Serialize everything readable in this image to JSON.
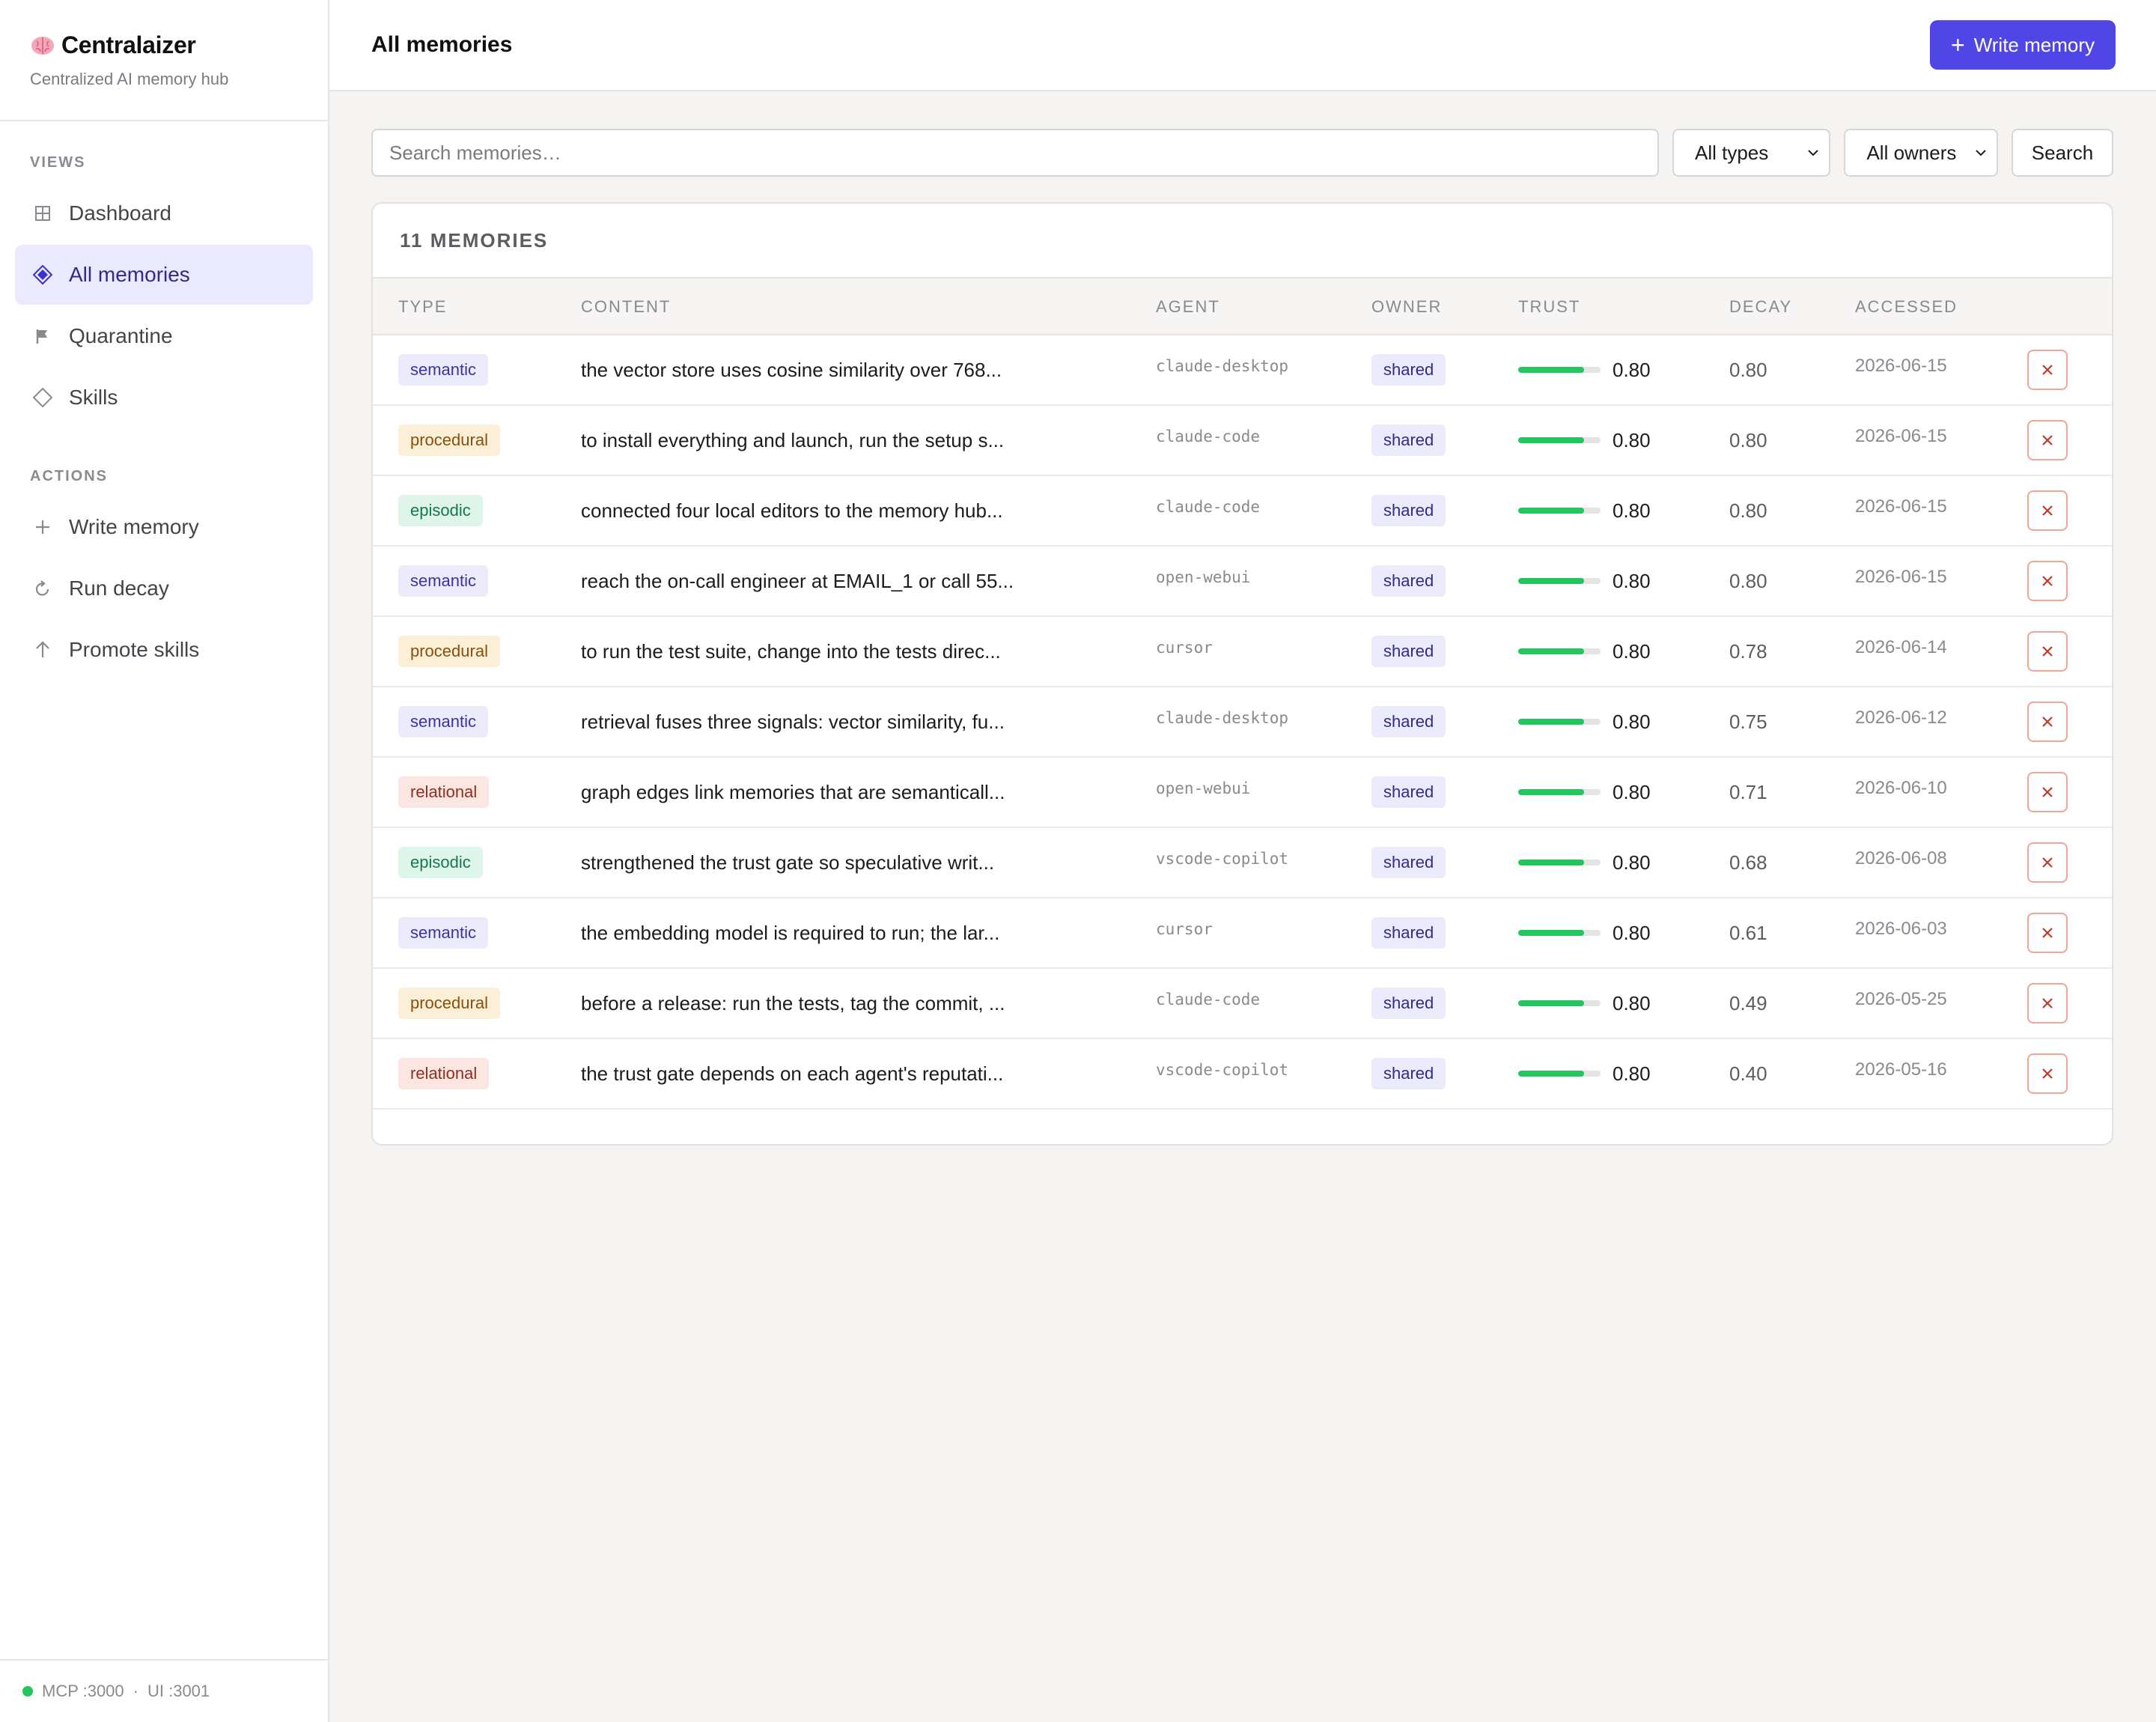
{
  "app": {
    "name": "Centralaizer",
    "subtitle": "Centralized AI memory hub"
  },
  "sidebar": {
    "views_label": "VIEWS",
    "views": [
      {
        "label": "Dashboard",
        "icon": "grid-icon"
      },
      {
        "label": "All memories",
        "icon": "diamond-filled-icon",
        "active": true
      },
      {
        "label": "Quarantine",
        "icon": "flag-icon"
      },
      {
        "label": "Skills",
        "icon": "diamond-outline-icon"
      }
    ],
    "actions_label": "ACTIONS",
    "actions": [
      {
        "label": "Write memory",
        "icon": "plus-icon"
      },
      {
        "label": "Run decay",
        "icon": "refresh-icon"
      },
      {
        "label": "Promote skills",
        "icon": "arrow-up-icon"
      }
    ],
    "footer": {
      "mcp": "MCP :3000",
      "separator": "·",
      "ui": "UI :3001",
      "status_color": "#22c55e"
    }
  },
  "header": {
    "title": "All memories",
    "write_button": "Write memory"
  },
  "filters": {
    "search_placeholder": "Search memories…",
    "type_select": "All types",
    "owner_select": "All owners",
    "search_button": "Search"
  },
  "table": {
    "count_label": "11 MEMORIES",
    "columns": [
      "TYPE",
      "CONTENT",
      "AGENT",
      "OWNER",
      "TRUST",
      "DECAY",
      "ACCESSED"
    ],
    "rows": [
      {
        "type": "semantic",
        "content": "the vector store uses cosine similarity over 768...",
        "agent": "claude-desktop",
        "owner": "shared",
        "trust": "0.80",
        "trust_fraction": 0.8,
        "decay": "0.80",
        "accessed": "2026-06-15"
      },
      {
        "type": "procedural",
        "content": "to install everything and launch, run the setup s...",
        "agent": "claude-code",
        "owner": "shared",
        "trust": "0.80",
        "trust_fraction": 0.8,
        "decay": "0.80",
        "accessed": "2026-06-15"
      },
      {
        "type": "episodic",
        "content": "connected four local editors to the memory hub...",
        "agent": "claude-code",
        "owner": "shared",
        "trust": "0.80",
        "trust_fraction": 0.8,
        "decay": "0.80",
        "accessed": "2026-06-15"
      },
      {
        "type": "semantic",
        "content": "reach the on-call engineer at EMAIL_1 or call 55...",
        "agent": "open-webui",
        "owner": "shared",
        "trust": "0.80",
        "trust_fraction": 0.8,
        "decay": "0.80",
        "accessed": "2026-06-15"
      },
      {
        "type": "procedural",
        "content": "to run the test suite, change into the tests direc...",
        "agent": "cursor",
        "owner": "shared",
        "trust": "0.80",
        "trust_fraction": 0.8,
        "decay": "0.78",
        "accessed": "2026-06-14"
      },
      {
        "type": "semantic",
        "content": "retrieval fuses three signals: vector similarity, fu...",
        "agent": "claude-desktop",
        "owner": "shared",
        "trust": "0.80",
        "trust_fraction": 0.8,
        "decay": "0.75",
        "accessed": "2026-06-12"
      },
      {
        "type": "relational",
        "content": "graph edges link memories that are semanticall...",
        "agent": "open-webui",
        "owner": "shared",
        "trust": "0.80",
        "trust_fraction": 0.8,
        "decay": "0.71",
        "accessed": "2026-06-10"
      },
      {
        "type": "episodic",
        "content": "strengthened the trust gate so speculative writ...",
        "agent": "vscode-copilot",
        "owner": "shared",
        "trust": "0.80",
        "trust_fraction": 0.8,
        "decay": "0.68",
        "accessed": "2026-06-08"
      },
      {
        "type": "semantic",
        "content": "the embedding model is required to run; the lar...",
        "agent": "cursor",
        "owner": "shared",
        "trust": "0.80",
        "trust_fraction": 0.8,
        "decay": "0.61",
        "accessed": "2026-06-03"
      },
      {
        "type": "procedural",
        "content": "before a release: run the tests, tag the commit, ...",
        "agent": "claude-code",
        "owner": "shared",
        "trust": "0.80",
        "trust_fraction": 0.8,
        "decay": "0.49",
        "accessed": "2026-05-25"
      },
      {
        "type": "relational",
        "content": "the trust gate depends on each agent's reputati...",
        "agent": "vscode-copilot",
        "owner": "shared",
        "trust": "0.80",
        "trust_fraction": 0.8,
        "decay": "0.40",
        "accessed": "2026-05-16"
      }
    ]
  },
  "colors": {
    "accent": "#4f46e5",
    "trust_bar": "#22c55e",
    "delete_border": "#f0a596",
    "delete_icon": "#c0392b"
  }
}
